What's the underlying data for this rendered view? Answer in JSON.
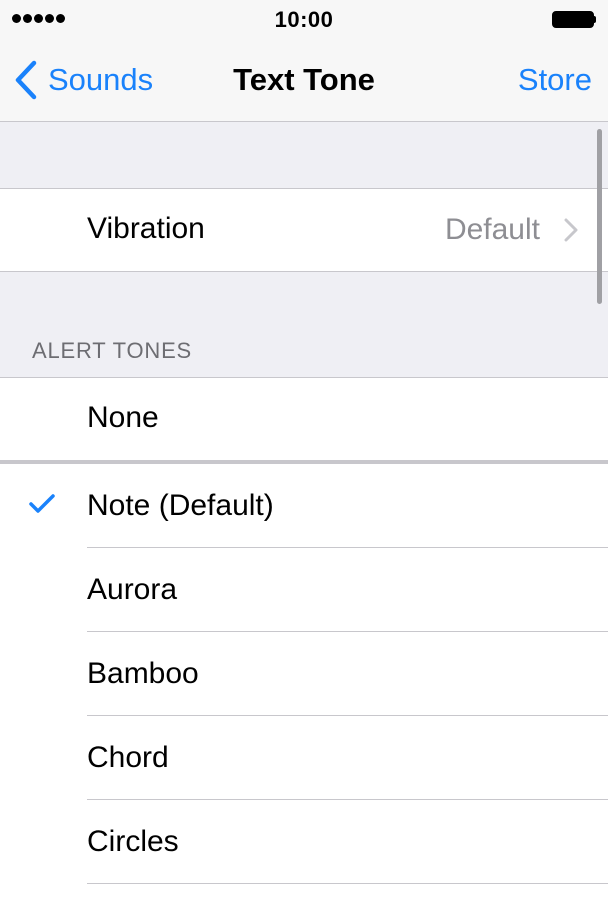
{
  "status_bar": {
    "time": "10:00",
    "signal_bars": 5,
    "battery_icon": "battery-full-icon"
  },
  "nav": {
    "back_label": "Sounds",
    "title": "Text Tone",
    "action_label": "Store",
    "accent_color": "#1a82fb"
  },
  "vibration": {
    "label": "Vibration",
    "value": "Default"
  },
  "alert_tones": {
    "header": "ALERT TONES",
    "none_label": "None",
    "items": [
      {
        "label": "Note (Default)",
        "selected": true
      },
      {
        "label": "Aurora",
        "selected": false
      },
      {
        "label": "Bamboo",
        "selected": false
      },
      {
        "label": "Chord",
        "selected": false
      },
      {
        "label": "Circles",
        "selected": false
      }
    ]
  }
}
